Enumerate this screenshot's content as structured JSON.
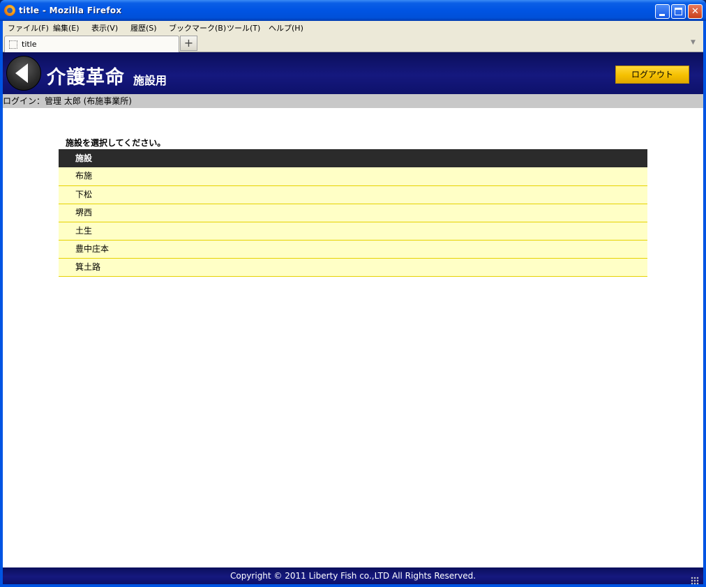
{
  "window": {
    "title": "title - Mozilla Firefox",
    "icon": "firefox-icon"
  },
  "menu": [
    "ファイル(F)",
    "編集(E)",
    "表示(V)",
    "履歴(S)",
    "ブックマーク(B)",
    "ツール(T)",
    "ヘルプ(H)"
  ],
  "tabs": {
    "active_label": "title",
    "new_tab_label": "+"
  },
  "header": {
    "title": "介護革命",
    "subtitle": "施設用",
    "logout_label": "ログアウト"
  },
  "login_info": "ログイン：管理 太郎 (布施事業所)",
  "facility_selection": {
    "instruction": "施設を選択してください。",
    "column_header": "施設",
    "facilities": [
      "布施",
      "下松",
      "堺西",
      "土生",
      "豊中庄本",
      "箕土路"
    ]
  },
  "footer": {
    "copyright": "Copyright © 2011 Liberty Fish co.,LTD All Rights Reserved."
  },
  "colors": {
    "header_bg": "#15187e",
    "logout_button": "#f5c000",
    "table_header_bg": "#2b2b2b",
    "table_row_bg": "#ffffc6",
    "table_row_border": "#e6d200",
    "login_bar_bg": "#c8c8c8"
  }
}
